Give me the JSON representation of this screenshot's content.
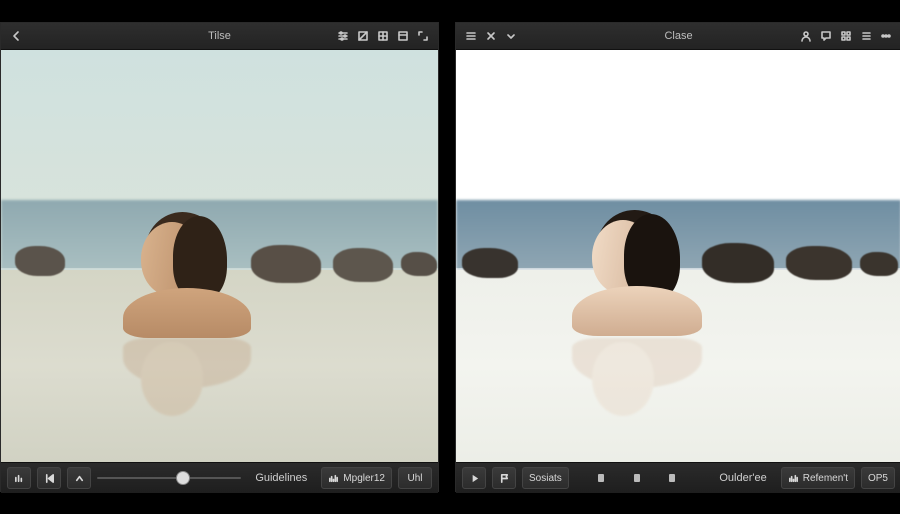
{
  "panes": {
    "left": {
      "title": "Tilse",
      "top_icons_left": [
        "chevron-left"
      ],
      "top_icons_right": [
        "sliders",
        "gradient",
        "grid",
        "panel",
        "expand"
      ],
      "bottom": {
        "icons_left": [
          "levels",
          "skip",
          "chevron-up"
        ],
        "center_label": "Guidelines",
        "slider_pos": 0.55,
        "buttons_right": [
          {
            "icon": "histogram",
            "label": "Mpgler12"
          },
          {
            "icon": null,
            "label": "Uhl"
          }
        ]
      }
    },
    "right": {
      "title": "Clase",
      "top_icons_left": [
        "menu",
        "close",
        "chevron-down"
      ],
      "top_icons_right": [
        "user",
        "comment",
        "grid",
        "list",
        "more"
      ],
      "bottom": {
        "icons_left": [
          "play",
          "flag"
        ],
        "after_icons_label": "Sosiats",
        "center_label": "Oulder'ee",
        "marks": [
          0.18,
          0.45,
          0.72
        ],
        "buttons_right": [
          {
            "icon": "histogram",
            "label": "Refemen't"
          },
          {
            "icon": null,
            "label": "OP5"
          }
        ]
      }
    }
  },
  "colors": {
    "left": {
      "sky_top": "#cfe1df",
      "sky_bot": "#d8e3db",
      "sea": "#9fb8bd",
      "water": "#d7d8c7",
      "skin": "#caa27f",
      "hair": "#3a2a1e",
      "rock": "#5a534b"
    },
    "right": {
      "sky_top": "#f4faf9",
      "sky_bot": "#eef5f3",
      "sea": "#6f8ea2",
      "water": "#f2f3ef",
      "skin": "#e6cdb9",
      "hair": "#221a14",
      "rock": "#38332e"
    }
  }
}
